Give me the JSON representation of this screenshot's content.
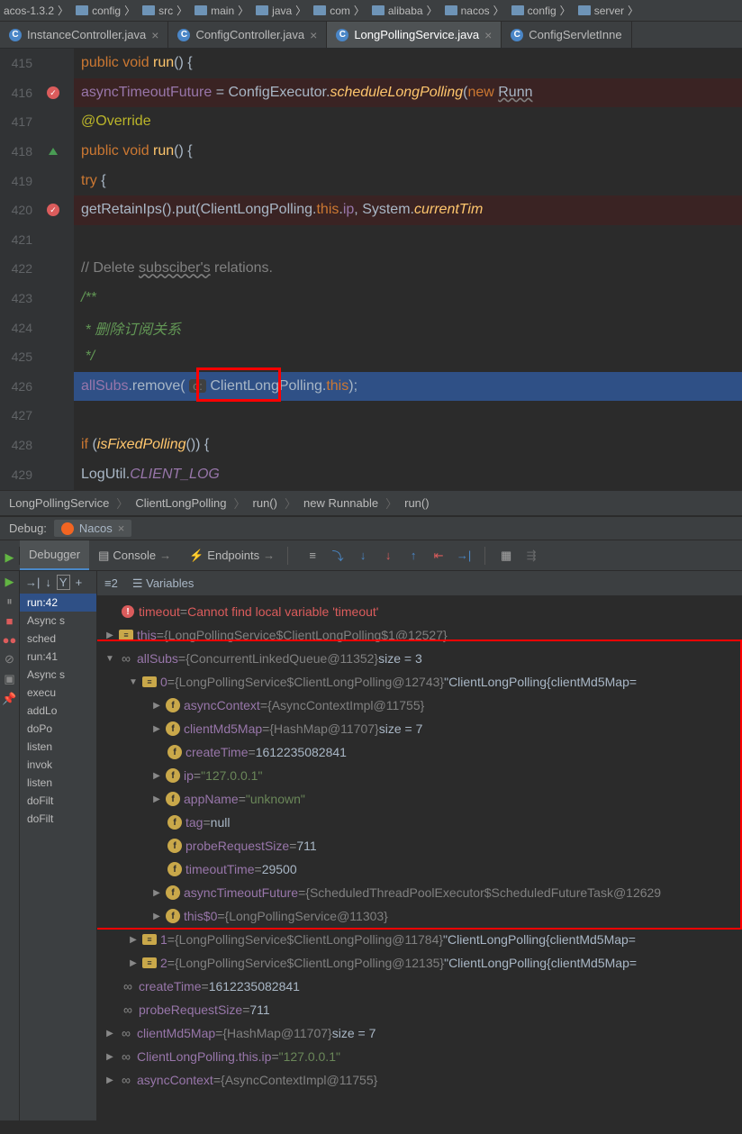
{
  "topCrumbs": [
    "acos-1.3.2",
    "config",
    "src",
    "main",
    "java",
    "com",
    "alibaba",
    "nacos",
    "config",
    "server"
  ],
  "tabs": [
    {
      "label": "InstanceController.java",
      "active": false
    },
    {
      "label": "ConfigController.java",
      "active": false
    },
    {
      "label": "LongPollingService.java",
      "active": true
    },
    {
      "label": "ConfigServletInne",
      "active": false
    }
  ],
  "lines": [
    {
      "n": "415",
      "bp": false,
      "up": false
    },
    {
      "n": "416",
      "bp": true,
      "check": true,
      "up": false
    },
    {
      "n": "417",
      "bp": false,
      "up": false
    },
    {
      "n": "418",
      "bp": false,
      "up": true
    },
    {
      "n": "419",
      "bp": false,
      "up": false
    },
    {
      "n": "420",
      "bp": true,
      "check": true,
      "up": false
    },
    {
      "n": "421",
      "bp": false,
      "up": false
    },
    {
      "n": "422",
      "bp": false,
      "up": false
    },
    {
      "n": "423",
      "bp": false,
      "up": false
    },
    {
      "n": "424",
      "bp": false,
      "up": false
    },
    {
      "n": "425",
      "bp": false,
      "up": false
    },
    {
      "n": "426",
      "bp": false,
      "up": false
    },
    {
      "n": "427",
      "bp": false,
      "up": false
    },
    {
      "n": "428",
      "bp": false,
      "up": false
    },
    {
      "n": "429",
      "bp": false,
      "up": false
    }
  ],
  "code": {
    "l415_kw": "public void ",
    "l415_m": "run",
    "l415_r": "() {",
    "l416_f": "asyncTimeoutFuture",
    "l416_eq": " = ConfigExecutor.",
    "l416_m": "scheduleLongPolling",
    "l416_r": "(",
    "l416_kw": "new ",
    "l416_c": "Runn",
    "l417_a": "@Override",
    "l418_kw": "public void ",
    "l418_m": "run",
    "l418_r": "() {",
    "l419_kw": "try ",
    "l419_r": "{",
    "l420_m1": "getRetainIps().put(ClientLongPolling.",
    "l420_kw": "this",
    "l420_m2": ".",
    "l420_f": "ip",
    "l420_m3": ", System.",
    "l420_m4": "currentTim",
    "l422": "// Delete ",
    "l422_w": "subsciber's",
    "l422_r": " relations.",
    "l423": "/**",
    "l424": " * 删除订阅关系",
    "l425": " */",
    "l426_f": "allSubs",
    "l426_m": ".remove( ",
    "l426_ph": "o:",
    "l426_r": " ClientLongPolling.",
    "l426_kw": "this",
    "l426_e": ");",
    "l428_kw": "if ",
    "l428_r": "(",
    "l428_m": "isFixedPolling",
    "l428_e": "()) {",
    "l429_c": "LogUtil.",
    "l429_f": "CLIENT_LOG"
  },
  "navCrumbs": [
    "LongPollingService",
    "ClientLongPolling",
    "run()",
    "new Runnable",
    "run()"
  ],
  "debugLabel": "Debug:",
  "nacosLabel": "Nacos",
  "dbgTabs": {
    "debugger": "Debugger",
    "console": "Console",
    "endpoints": "Endpoints"
  },
  "varsHeader": "Variables",
  "framesHeader": "≡2",
  "frames": [
    {
      "label": "run:42",
      "sel": true
    },
    {
      "label": "Async s",
      "sel": false
    },
    {
      "label": "  sched",
      "sel": false
    },
    {
      "label": "  run:41",
      "sel": false
    },
    {
      "label": "Async s",
      "sel": false
    },
    {
      "label": "  execu",
      "sel": false
    },
    {
      "label": "addLo",
      "sel": false
    },
    {
      "label": "doPo",
      "sel": false
    },
    {
      "label": "listen",
      "sel": false
    },
    {
      "label": "invok",
      "sel": false
    },
    {
      "label": "listen",
      "sel": false
    },
    {
      "label": "doFilt",
      "sel": false
    },
    {
      "label": "doFilt",
      "sel": false
    }
  ],
  "vars": {
    "timeout": {
      "name": "timeout",
      "err": "Cannot find local variable 'timeout'"
    },
    "this": {
      "name": "this",
      "val": "{LongPollingService$ClientLongPolling$1@12527}"
    },
    "allSubs": {
      "name": "allSubs",
      "val": "{ConcurrentLinkedQueue@11352}",
      "extra": "  size = 3"
    },
    "idx0": {
      "name": "0",
      "val": "{LongPollingService$ClientLongPolling@12743}",
      "extra": " \"ClientLongPolling{clientMd5Map="
    },
    "asyncContext": {
      "name": "asyncContext",
      "val": "{AsyncContextImpl@11755}"
    },
    "clientMd5Map": {
      "name": "clientMd5Map",
      "val": "{HashMap@11707}",
      "extra": "  size = 7"
    },
    "createTime": {
      "name": "createTime",
      "val": "1612235082841"
    },
    "ip": {
      "name": "ip",
      "val": "\"127.0.0.1\""
    },
    "appName": {
      "name": "appName",
      "val": "\"unknown\""
    },
    "tag": {
      "name": "tag",
      "val": "null"
    },
    "probeRequestSize": {
      "name": "probeRequestSize",
      "val": "711"
    },
    "timeoutTime": {
      "name": "timeoutTime",
      "val": "29500"
    },
    "asyncTimeoutFuture": {
      "name": "asyncTimeoutFuture",
      "val": "{ScheduledThreadPoolExecutor$ScheduledFutureTask@12629"
    },
    "this0": {
      "name": "this$0",
      "val": "{LongPollingService@11303}"
    },
    "idx1": {
      "name": "1",
      "val": "{LongPollingService$ClientLongPolling@11784}",
      "extra": " \"ClientLongPolling{clientMd5Map="
    },
    "idx2": {
      "name": "2",
      "val": "{LongPollingService$ClientLongPolling@12135}",
      "extra": " \"ClientLongPolling{clientMd5Map="
    },
    "createTimeOut": {
      "name": "createTime",
      "val": "1612235082841"
    },
    "probeRequestSizeOut": {
      "name": "probeRequestSize",
      "val": "711"
    },
    "clientMd5MapOut": {
      "name": "clientMd5Map",
      "val": "{HashMap@11707}",
      "extra": "  size = 7"
    },
    "clpIp": {
      "name": "ClientLongPolling.this.ip",
      "val": "\"127.0.0.1\""
    },
    "asyncContextOut": {
      "name": "asyncContext",
      "val": "{AsyncContextImpl@11755}"
    }
  }
}
